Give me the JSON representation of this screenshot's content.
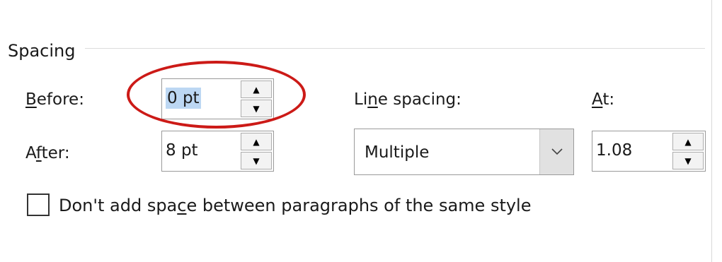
{
  "group": {
    "title": "Spacing"
  },
  "before": {
    "label_pre": "",
    "label_key": "B",
    "label_post": "efore:",
    "value": "0 pt"
  },
  "after": {
    "label_pre": "A",
    "label_key": "f",
    "label_post": "ter:",
    "value": "8 pt"
  },
  "line_spacing": {
    "label_pre": "Li",
    "label_key": "n",
    "label_post": "e spacing:",
    "value": "Multiple"
  },
  "at": {
    "label_pre": "",
    "label_key": "A",
    "label_post": "t:",
    "value": "1.08"
  },
  "checkbox": {
    "label_pre": "Don't add spa",
    "label_key": "c",
    "label_post": "e between paragraphs of the same style",
    "checked": false
  },
  "spin_up_glyph": "▲",
  "spin_down_glyph": "▼",
  "annotation_color": "#cc1a17",
  "selection_color": "#bcd7f3"
}
